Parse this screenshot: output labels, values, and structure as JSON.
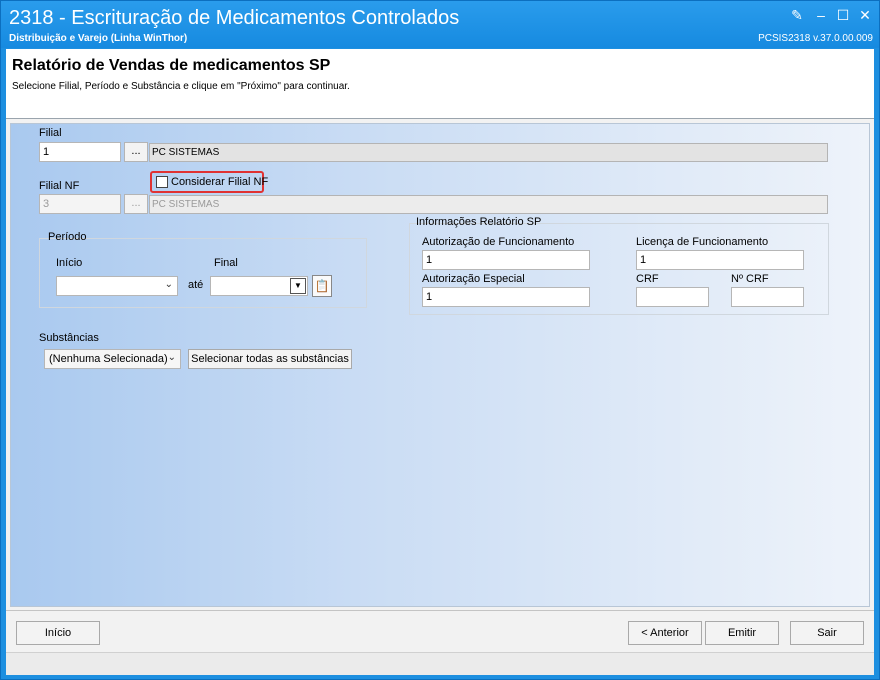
{
  "window": {
    "title": "2318 - Escrituração de Medicamentos Controlados",
    "subtitle": "Distribuição e Varejo (Linha WinThor)",
    "version": "PCSIS2318  v.37.0.00.009"
  },
  "header": {
    "title": "Relatório de Vendas de medicamentos SP",
    "instructions": "Selecione Filial, Período e Substância e clique em \"Próximo\" para continuar."
  },
  "filial": {
    "label": "Filial",
    "code": "1",
    "lookup_label": "...",
    "name": "PC SISTEMAS"
  },
  "filial_nf": {
    "label": "Filial NF",
    "checkbox_label": "Considerar Filial NF",
    "checked": false,
    "code": "3",
    "lookup_label": "...",
    "name": "PC SISTEMAS"
  },
  "periodo": {
    "title": "Período",
    "inicio_label": "Início",
    "inicio_value": "",
    "ate_label": "até",
    "final_label": "Final",
    "final_value": ""
  },
  "info_sp": {
    "title": "Informações Relatório SP",
    "aut_func_label": "Autorização de Funcionamento",
    "aut_func_value": "1",
    "lic_func_label": "Licença de Funcionamento",
    "lic_func_value": "1",
    "aut_esp_label": "Autorização Especial",
    "aut_esp_value": "1",
    "crf_label": "CRF",
    "crf_value": "",
    "num_crf_label": "Nº CRF",
    "num_crf_value": ""
  },
  "substancias": {
    "label": "Substâncias",
    "selected": "(Nenhuma Selecionada)",
    "select_all_label": "Selecionar todas as substâncias"
  },
  "footer": {
    "inicio_label": "Início",
    "anterior_label": "< Anterior",
    "emitir_label": "Emitir",
    "sair_label": "Sair"
  }
}
